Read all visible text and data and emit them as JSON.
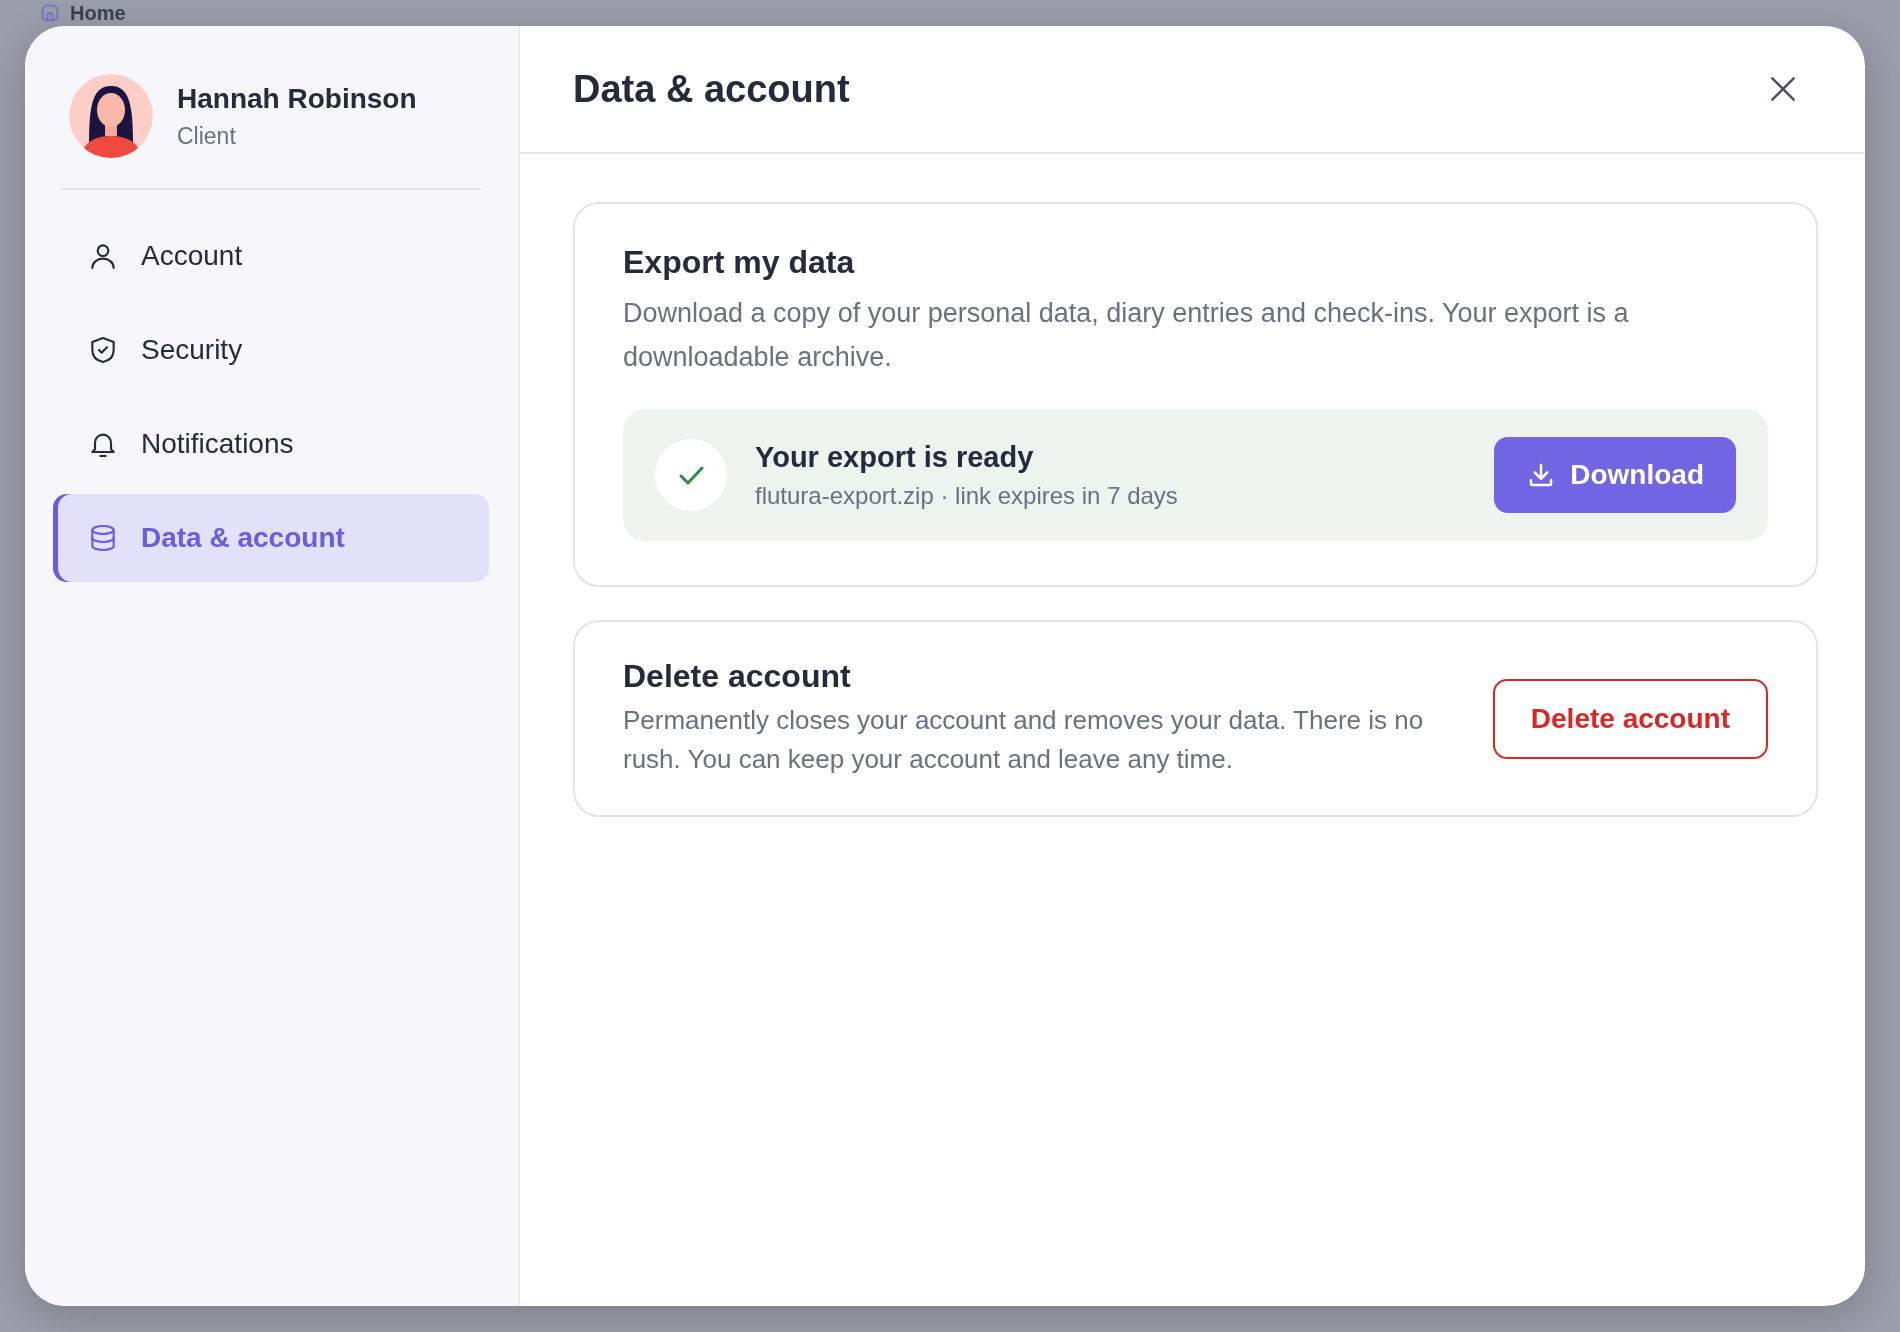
{
  "backdrop": {
    "title": "Home"
  },
  "profile": {
    "name": "Hannah Robinson",
    "role": "Client"
  },
  "nav": [
    {
      "label": "Account",
      "selected": false
    },
    {
      "label": "Security",
      "selected": false
    },
    {
      "label": "Notifications",
      "selected": false
    },
    {
      "label": "Data & account",
      "selected": true
    }
  ],
  "dialog": {
    "title": "Data & account"
  },
  "export_card": {
    "title": "Export my data",
    "description": "Download a copy of your personal data, diary entries and check-ins. Your export is a downloadable archive.",
    "status": {
      "title": "Your export is ready",
      "detail": "flutura-export.zip · link expires in 7 days"
    },
    "button": "Download"
  },
  "delete_card": {
    "title": "Delete account",
    "description": "Permanently closes your account and removes your data. There is no rush. You can keep your account and leave any time.",
    "button": "Delete account"
  }
}
